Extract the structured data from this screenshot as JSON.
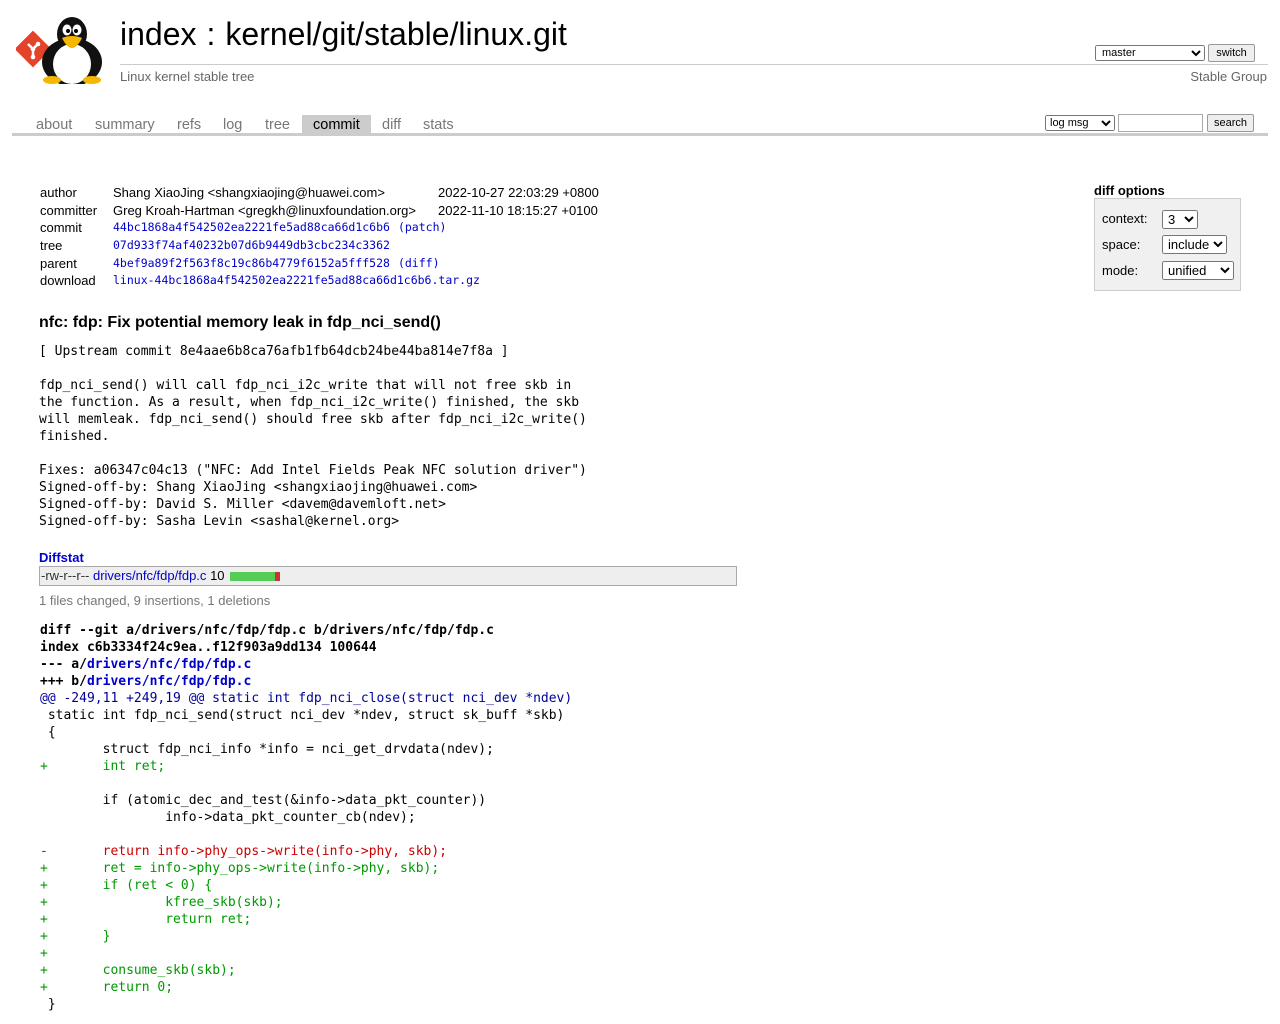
{
  "header": {
    "repo_index": "index",
    "separator": ":",
    "repo_path": "kernel/git/stable/linux.git",
    "subtitle": "Linux kernel stable tree",
    "branch": "master",
    "switch_label": "switch",
    "owner": "Stable Group"
  },
  "tabs": [
    {
      "label": "about"
    },
    {
      "label": "summary"
    },
    {
      "label": "refs"
    },
    {
      "label": "log"
    },
    {
      "label": "tree"
    },
    {
      "label": "commit",
      "active": true
    },
    {
      "label": "diff"
    },
    {
      "label": "stats"
    }
  ],
  "search": {
    "scope": "log msg",
    "query": "",
    "button": "search"
  },
  "commit_info": {
    "author_label": "author",
    "author": "Shang XiaoJing <shangxiaojing@huawei.com>",
    "author_date": "2022-10-27 22:03:29 +0800",
    "committer_label": "committer",
    "committer": "Greg Kroah-Hartman <gregkh@linuxfoundation.org>",
    "committer_date": "2022-11-10 18:15:27 +0100",
    "commit_label": "commit",
    "commit": "44bc1868a4f542502ea2221fe5ad88ca66d1c6b6",
    "commit_extra": "(patch)",
    "tree_label": "tree",
    "tree": "07d933f74af40232b07d6b9449db3cbc234c3362",
    "parent_label": "parent",
    "parent": "4bef9a89f2f563f8c19c86b4779f6152a5fff528",
    "parent_extra": "(diff)",
    "download_label": "download",
    "download": "linux-44bc1868a4f542502ea2221fe5ad88ca66d1c6b6.tar.gz"
  },
  "diff_options": {
    "title": "diff options",
    "context_label": "context:",
    "context": "3",
    "space_label": "space:",
    "space": "include",
    "mode_label": "mode:",
    "mode": "unified"
  },
  "message": {
    "subject": "nfc: fdp: Fix potential memory leak in fdp_nci_send()",
    "body": "[ Upstream commit 8e4aae6b8ca76afb1fb64dcb24be44ba814e7f8a ]\n\nfdp_nci_send() will call fdp_nci_i2c_write that will not free skb in\nthe function. As a result, when fdp_nci_i2c_write() finished, the skb\nwill memleak. fdp_nci_send() should free skb after fdp_nci_i2c_write()\nfinished.\n\nFixes: a06347c04c13 (\"NFC: Add Intel Fields Peak NFC solution driver\")\nSigned-off-by: Shang XiaoJing <shangxiaojing@huawei.com>\nSigned-off-by: David S. Miller <davem@davemloft.net>\nSigned-off-by: Sasha Levin <sashal@kernel.org>"
  },
  "diffstat": {
    "header": "Diffstat",
    "mode": "-rw-r--r--",
    "file": "drivers/nfc/fdp/fdp.c",
    "count": "10",
    "insertions": 9,
    "deletions": 1,
    "summary": "1 files changed, 9 insertions, 1 deletions",
    "insert_color": "#55cc55",
    "delete_color": "#cc3333"
  },
  "diff": {
    "git_line": "diff --git a/drivers/nfc/fdp/fdp.c b/drivers/nfc/fdp/fdp.c",
    "index_line": "index c6b3334f24c9ea..f12f903a9dd134 100644",
    "minus_prefix": "--- a/",
    "minus_file": "drivers/nfc/fdp/fdp.c",
    "plus_prefix": "+++ b/",
    "plus_file": "drivers/nfc/fdp/fdp.c",
    "hunk": "@@ -249,11 +249,19 @@ static int fdp_nci_close(struct nci_dev *ndev)",
    "lines": [
      {
        "t": "ctx",
        "text": " static int fdp_nci_send(struct nci_dev *ndev, struct sk_buff *skb)"
      },
      {
        "t": "ctx",
        "text": " {"
      },
      {
        "t": "ctx",
        "text": " \tstruct fdp_nci_info *info = nci_get_drvdata(ndev);"
      },
      {
        "t": "add",
        "text": "+\tint ret;"
      },
      {
        "t": "ctx",
        "text": " "
      },
      {
        "t": "ctx",
        "text": " \tif (atomic_dec_and_test(&info->data_pkt_counter))"
      },
      {
        "t": "ctx",
        "text": " \t\tinfo->data_pkt_counter_cb(ndev);"
      },
      {
        "t": "ctx",
        "text": " "
      },
      {
        "t": "del",
        "text": "-\treturn info->phy_ops->write(info->phy, skb);"
      },
      {
        "t": "add",
        "text": "+\tret = info->phy_ops->write(info->phy, skb);"
      },
      {
        "t": "add",
        "text": "+\tif (ret < 0) {"
      },
      {
        "t": "add",
        "text": "+\t\tkfree_skb(skb);"
      },
      {
        "t": "add",
        "text": "+\t\treturn ret;"
      },
      {
        "t": "add",
        "text": "+\t}"
      },
      {
        "t": "add",
        "text": "+"
      },
      {
        "t": "add",
        "text": "+\tconsume_skb(skb);"
      },
      {
        "t": "add",
        "text": "+\treturn 0;"
      },
      {
        "t": "ctx",
        "text": " }"
      }
    ]
  }
}
